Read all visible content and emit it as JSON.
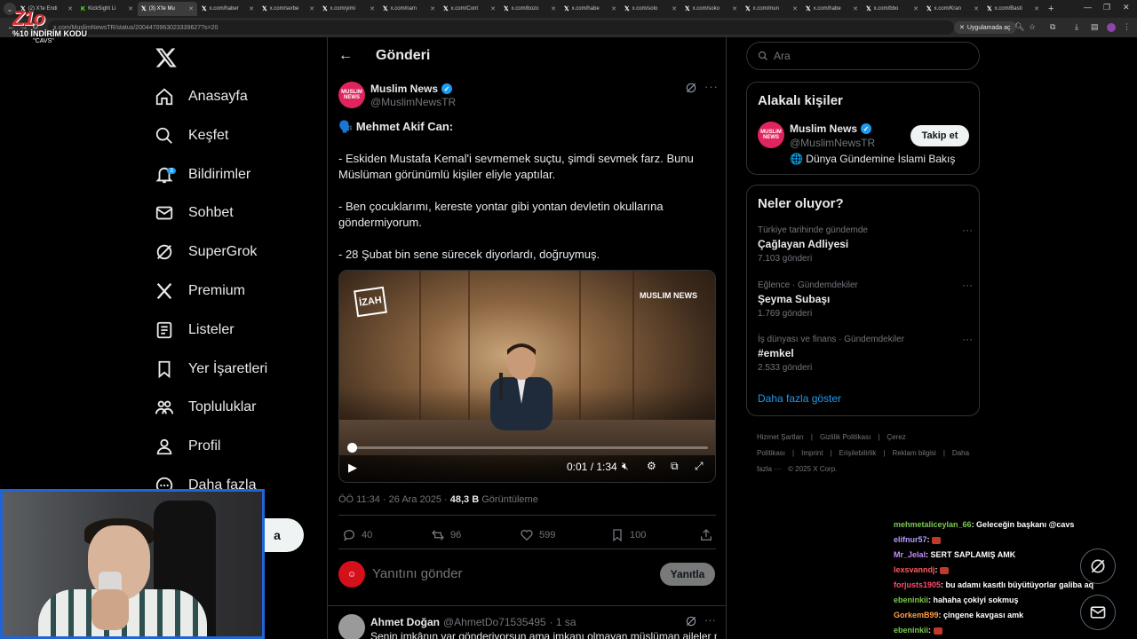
{
  "browser": {
    "tabs": [
      {
        "label": "(2) X'te Endi",
        "icon": "x-icon"
      },
      {
        "label": "KickSight Li",
        "icon": "kick-icon"
      },
      {
        "label": "(3) X'te Mu",
        "icon": "x-icon",
        "active": true
      },
      {
        "label": "x.com/haber",
        "icon": "x-icon"
      },
      {
        "label": "x.com/serbe",
        "icon": "x-icon"
      },
      {
        "label": "x.com/yimi",
        "icon": "x-icon"
      },
      {
        "label": "x.com/nam",
        "icon": "x-icon"
      },
      {
        "label": "x.com/Cont",
        "icon": "x-icon"
      },
      {
        "label": "x.com/bozo",
        "icon": "x-icon"
      },
      {
        "label": "x.com/habe",
        "icon": "x-icon"
      },
      {
        "label": "x.com/solo",
        "icon": "x-icon"
      },
      {
        "label": "x.com/soko",
        "icon": "x-icon"
      },
      {
        "label": "x.com/mun",
        "icon": "x-icon"
      },
      {
        "label": "x.com/habe",
        "icon": "x-icon"
      },
      {
        "label": "x.com/bbo",
        "icon": "x-icon"
      },
      {
        "label": "x.com/Kran",
        "icon": "x-icon"
      },
      {
        "label": "x.com/Basti",
        "icon": "x-icon"
      }
    ],
    "url": "x.com/MuslimNewsTR/status/2004470963023339627?s=20",
    "open_app": "Uygulamada aç"
  },
  "overlay": {
    "logo": "Z1o",
    "promo_line1": "%10 İNDİRİM KODU",
    "promo_line2": "\"CAVS\""
  },
  "nav": {
    "items": [
      {
        "label": "Anasayfa",
        "icon": "home-icon"
      },
      {
        "label": "Keşfet",
        "icon": "search-icon"
      },
      {
        "label": "Bildirimler",
        "icon": "bell-icon",
        "badge": "3"
      },
      {
        "label": "Sohbet",
        "icon": "mail-icon"
      },
      {
        "label": "SuperGrok",
        "icon": "grok-icon"
      },
      {
        "label": "Premium",
        "icon": "x-icon"
      },
      {
        "label": "Listeler",
        "icon": "list-icon"
      },
      {
        "label": "Yer İşaretleri",
        "icon": "bookmark-icon"
      },
      {
        "label": "Topluluklar",
        "icon": "community-icon"
      },
      {
        "label": "Profil",
        "icon": "profile-icon"
      },
      {
        "label": "Daha fazla",
        "icon": "more-circle-icon"
      }
    ],
    "post_button": "a"
  },
  "main": {
    "header_title": "Gönderi",
    "post": {
      "author_name": "Muslim News",
      "author_handle": "@MuslimNewsTR",
      "avatar_text": "MUSLIM NEWS",
      "title_emoji": "🗣️",
      "title": "Mehmet Akif Can:",
      "paragraphs": [
        "- Eskiden Mustafa Kemal'i sevmemek suçtu, şimdi sevmek farz. Bunu Müslüman görünümlü kişiler eliyle yaptılar.",
        "- Ben çocuklarımı, kereste yontar gibi yontan devletin okullarına göndermiyorum.",
        "- 28 Şubat bin sene sürecek diyorlardı, doğruymuş."
      ],
      "video": {
        "brand_left": "İZAH",
        "brand_right": "MUSLIM NEWS",
        "current_time": "0:01",
        "duration": "1:34",
        "progress": 0.011
      },
      "timestamp": "ÖÖ 11:34 · 26 Ara 2025 · ",
      "views": "48,3 B",
      "views_label": " Görüntüleme",
      "replies": "40",
      "reposts": "96",
      "likes": "599",
      "bookmarks": "100"
    },
    "reply_placeholder": "Yanıtını gönder",
    "reply_button": "Yanıtla",
    "next_reply": {
      "name": "Ahmet Doğan",
      "handle": "@AhmetDo71535495",
      "time": "· 1 sa",
      "text": "Senin imkânın var gönderiyorsun ama imkanı olmayan müslüman aileler ne"
    }
  },
  "right": {
    "search_placeholder": "Ara",
    "related": {
      "title": "Alakalı kişiler",
      "name": "Muslim News",
      "handle": "@MuslimNewsTR",
      "bio": "🌐 Dünya Gündemine İslami Bakış",
      "follow": "Takip et"
    },
    "trends": {
      "title": "Neler oluyor?",
      "items": [
        {
          "meta": "Türkiye tarihinde gündemde",
          "name": "Çağlayan Adliyesi",
          "count": "7.103 gönderi"
        },
        {
          "meta": "Eğlence · Gündemdekiler",
          "name": "Şeyma Subaşı",
          "count": "1.769 gönderi"
        },
        {
          "meta": "İş dünyası ve finans · Gündemdekiler",
          "name": "#emkel",
          "count": "2.533 gönderi"
        }
      ],
      "show_more": "Daha fazla göster"
    },
    "footer": [
      "Hizmet Şartları",
      "|",
      "Gizlilik Politikası",
      "|",
      "Çerez Politikası",
      "|",
      "Imprint",
      "|",
      "Erişilebilirlik",
      "|",
      "Reklam bilgisi",
      "|",
      "Daha fazla ···",
      "© 2025 X Corp."
    ]
  },
  "chat": [
    {
      "user": "mehmetaliceylan_66",
      "color": "#7ec850",
      "msg": ": Geleceğin başkanı @cavs"
    },
    {
      "user": "elifnur57",
      "color": "#b49cff",
      "msg": ": ",
      "emote": true
    },
    {
      "user": "Mr_Jelal",
      "color": "#c88cff",
      "msg": ": SERT SAPLAMIŞ AMK"
    },
    {
      "user": "lexsvanndj",
      "color": "#ff5b5b",
      "msg": ": ",
      "emote": true
    },
    {
      "user": "forjusts1905",
      "color": "#ff4d6d",
      "msg": ": bu adamı kasıtlı büyütüyorlar galiba aq"
    },
    {
      "user": "ebeninkii",
      "color": "#7ec850",
      "msg": ": hahaha çokiyi sokmuş"
    },
    {
      "user": "GorkemB99",
      "color": "#ff9f43",
      "msg": ": çingene kavgası amk"
    },
    {
      "user": "ebeninkii",
      "color": "#7ec850",
      "msg": ": ",
      "emote": true
    }
  ]
}
